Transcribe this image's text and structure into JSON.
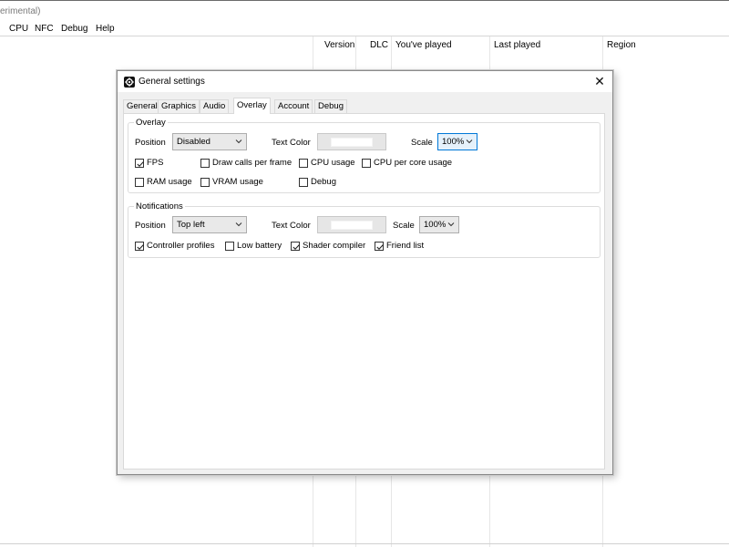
{
  "window": {
    "title_fragment": "erimental)",
    "menu": [
      "CPU",
      "NFC",
      "Debug",
      "Help"
    ],
    "columns": [
      "Version",
      "DLC",
      "You've played",
      "Last played",
      "Region"
    ]
  },
  "dialog": {
    "title": "General settings",
    "icon": "gear-icon",
    "close_label": "✕",
    "tabs": [
      "General",
      "Graphics",
      "Audio",
      "Overlay",
      "Account",
      "Debug"
    ],
    "active_tab": "Overlay",
    "overlay": {
      "legend": "Overlay",
      "position_label": "Position",
      "position_value": "Disabled",
      "text_color_label": "Text Color",
      "text_color_value": "#ffffff",
      "scale_label": "Scale",
      "scale_value": "100%",
      "checkboxes": [
        {
          "label": "FPS",
          "checked": true
        },
        {
          "label": "Draw calls per frame",
          "checked": false
        },
        {
          "label": "CPU usage",
          "checked": false
        },
        {
          "label": "CPU per core usage",
          "checked": false
        },
        {
          "label": "RAM usage",
          "checked": false
        },
        {
          "label": "VRAM usage",
          "checked": false
        },
        {
          "label": "Debug",
          "checked": false
        }
      ]
    },
    "notifications": {
      "legend": "Notifications",
      "position_label": "Position",
      "position_value": "Top left",
      "text_color_label": "Text Color",
      "text_color_value": "#ffffff",
      "scale_label": "Scale",
      "scale_value": "100%",
      "checkboxes": [
        {
          "label": "Controller profiles",
          "checked": true
        },
        {
          "label": "Low battery",
          "checked": false
        },
        {
          "label": "Shader compiler",
          "checked": true
        },
        {
          "label": "Friend list",
          "checked": true
        }
      ]
    }
  }
}
